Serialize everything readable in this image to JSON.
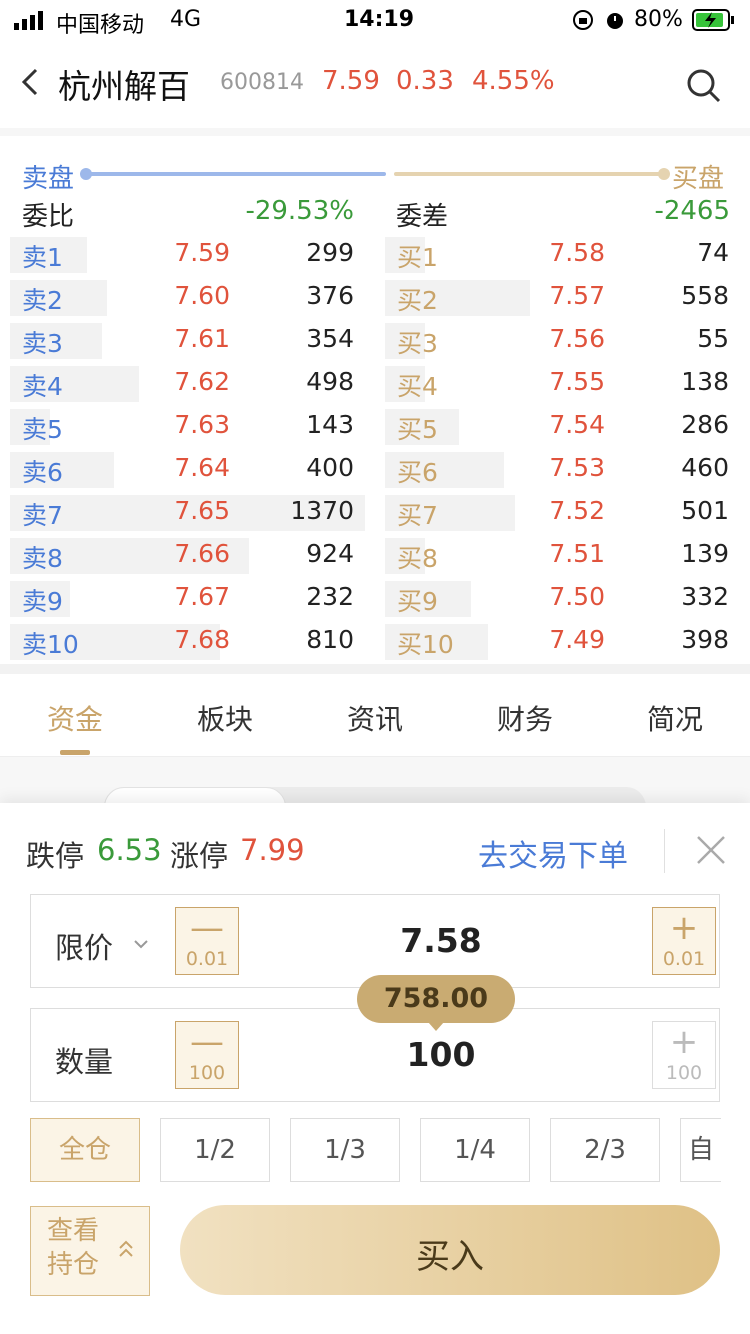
{
  "status": {
    "carrier": "中国移动",
    "network": "4G",
    "time": "14:19",
    "battery": "80%"
  },
  "header": {
    "name": "杭州解百",
    "code": "600814",
    "price": "7.59",
    "change": "0.33",
    "percent": "4.55%"
  },
  "orderbook": {
    "sell_label": "卖盘",
    "buy_label": "买盘",
    "ratio_label": "委比",
    "ratio_value": "-29.53%",
    "diff_label": "委差",
    "diff_value": "-2465",
    "sells": [
      {
        "label": "卖1",
        "price": "7.59",
        "volume": "299"
      },
      {
        "label": "卖2",
        "price": "7.60",
        "volume": "376"
      },
      {
        "label": "卖3",
        "price": "7.61",
        "volume": "354"
      },
      {
        "label": "卖4",
        "price": "7.62",
        "volume": "498"
      },
      {
        "label": "卖5",
        "price": "7.63",
        "volume": "143"
      },
      {
        "label": "卖6",
        "price": "7.64",
        "volume": "400"
      },
      {
        "label": "卖7",
        "price": "7.65",
        "volume": "1370"
      },
      {
        "label": "卖8",
        "price": "7.66",
        "volume": "924"
      },
      {
        "label": "卖9",
        "price": "7.67",
        "volume": "232"
      },
      {
        "label": "卖10",
        "price": "7.68",
        "volume": "810"
      }
    ],
    "buys": [
      {
        "label": "买1",
        "price": "7.58",
        "volume": "74"
      },
      {
        "label": "买2",
        "price": "7.57",
        "volume": "558"
      },
      {
        "label": "买3",
        "price": "7.56",
        "volume": "55"
      },
      {
        "label": "买4",
        "price": "7.55",
        "volume": "138"
      },
      {
        "label": "买5",
        "price": "7.54",
        "volume": "286"
      },
      {
        "label": "买6",
        "price": "7.53",
        "volume": "460"
      },
      {
        "label": "买7",
        "price": "7.52",
        "volume": "501"
      },
      {
        "label": "买8",
        "price": "7.51",
        "volume": "139"
      },
      {
        "label": "买9",
        "price": "7.50",
        "volume": "332"
      },
      {
        "label": "买10",
        "price": "7.49",
        "volume": "398"
      }
    ]
  },
  "tabs": [
    {
      "label": "资金",
      "active": true
    },
    {
      "label": "板块"
    },
    {
      "label": "资讯"
    },
    {
      "label": "财务"
    },
    {
      "label": "简况"
    }
  ],
  "trade": {
    "limit_down_label": "跌停",
    "limit_down": "6.53",
    "limit_up_label": "涨停",
    "limit_up": "7.99",
    "go_trade": "去交易下单",
    "price_type": "限价",
    "price_value": "7.58",
    "price_step_minus": "0.01",
    "price_step_plus": "0.01",
    "amount_tip": "758.00",
    "qty_label": "数量",
    "qty_value": "100",
    "qty_step_minus": "100",
    "qty_step_plus": "100",
    "quick": [
      "全仓",
      "1/2",
      "1/3",
      "1/4",
      "2/3",
      "自"
    ],
    "view_position": "查看持仓",
    "view_position_line1": "查看",
    "view_position_line2": "持仓",
    "buy_button": "买入"
  },
  "colors": {
    "red": "#e0533c",
    "green": "#3a9a3a",
    "blue": "#4a7bd6",
    "gold": "#c9a46a"
  }
}
